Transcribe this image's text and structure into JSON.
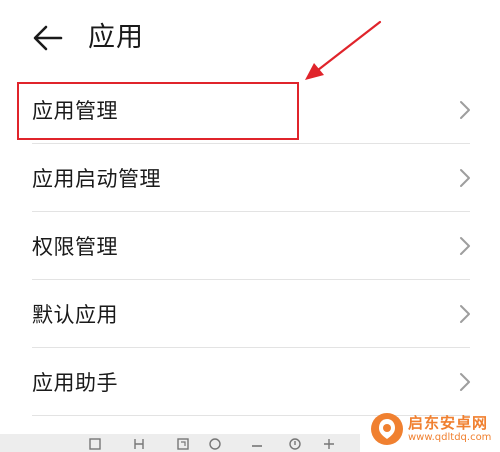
{
  "header": {
    "title": "应用",
    "back_icon": "arrow-left-icon"
  },
  "list": {
    "items": [
      {
        "label": "应用管理"
      },
      {
        "label": "应用启动管理"
      },
      {
        "label": "权限管理"
      },
      {
        "label": "默认应用"
      },
      {
        "label": "应用助手"
      }
    ],
    "chevron_icon": "chevron-right-icon"
  },
  "annotation": {
    "color": "#e0242b",
    "marks": [
      "highlight-box",
      "pointer-arrow"
    ]
  },
  "watermark": {
    "name": "启东安卓网",
    "url": "www.qdltdq.com",
    "color": "#f08030"
  },
  "colors": {
    "text": "#1a1a1a",
    "chevron": "#9e9e9e",
    "divider": "#e3e3e3",
    "toolbar": "#ededed"
  }
}
